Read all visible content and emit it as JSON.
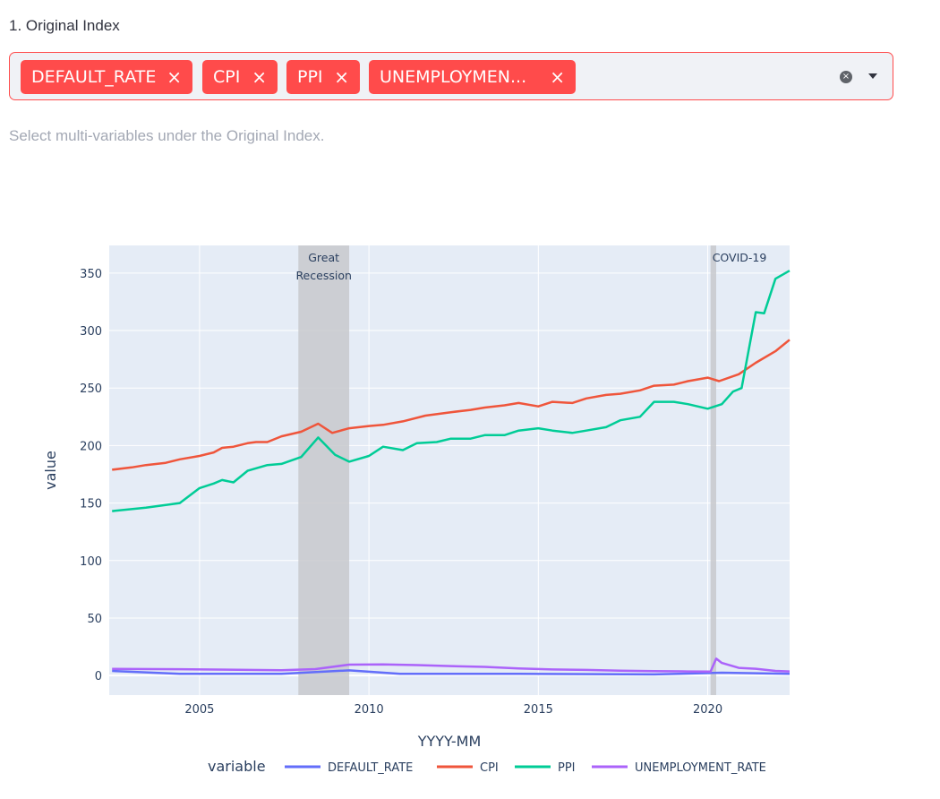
{
  "field": {
    "label": "1. Original Index",
    "chips": [
      "DEFAULT_RATE",
      "CPI",
      "PPI",
      "UNEMPLOYMEN..."
    ],
    "chip_remove_glyph": "×",
    "clear_icon": "clear-icon",
    "dropdown_icon": "chevron-down-icon",
    "help": "Select multi-variables under the Original Index."
  },
  "colors": {
    "accent": "#ff4b4b",
    "DEFAULT_RATE": "#636efa",
    "CPI": "#ef553b",
    "PPI": "#00cc96",
    "UNEMPLOYMENT_RATE": "#ab63fa",
    "plot_bg": "#e5ecf6",
    "shade": "#c8c9cc"
  },
  "chart_data": {
    "type": "line",
    "xlabel": "YYYY-MM",
    "ylabel": "value",
    "xlim": [
      "2002-05",
      "2022-06"
    ],
    "ylim": [
      -17,
      374
    ],
    "x_ticks": [
      2005,
      2010,
      2015,
      2020
    ],
    "y_ticks": [
      0,
      50,
      100,
      150,
      200,
      250,
      300,
      350
    ],
    "grid": true,
    "legend": {
      "title": "variable",
      "position": "bottom"
    },
    "shaded_regions": [
      {
        "label_lines": [
          "Great",
          "Recession"
        ],
        "start": "2007-12",
        "end": "2009-06"
      },
      {
        "label_lines": [
          "COVID-19"
        ],
        "start": "2020-02",
        "end": "2020-04"
      }
    ],
    "series": [
      {
        "name": "DEFAULT_RATE",
        "points": [
          [
            "2002-06",
            4
          ],
          [
            "2004-06",
            1.5
          ],
          [
            "2007-06",
            1.5
          ],
          [
            "2009-06",
            4.5
          ],
          [
            "2010-12",
            1.5
          ],
          [
            "2014-06",
            1.5
          ],
          [
            "2018-06",
            1
          ],
          [
            "2020-06",
            2.5
          ],
          [
            "2022-06",
            1.5
          ]
        ]
      },
      {
        "name": "CPI",
        "points": [
          [
            "2002-06",
            179
          ],
          [
            "2003-01",
            181
          ],
          [
            "2003-06",
            183
          ],
          [
            "2004-01",
            185
          ],
          [
            "2004-06",
            188
          ],
          [
            "2005-01",
            191
          ],
          [
            "2005-06",
            194
          ],
          [
            "2005-09",
            198
          ],
          [
            "2006-01",
            199
          ],
          [
            "2006-06",
            202
          ],
          [
            "2006-09",
            203
          ],
          [
            "2007-01",
            203
          ],
          [
            "2007-06",
            208
          ],
          [
            "2008-01",
            212
          ],
          [
            "2008-07",
            219
          ],
          [
            "2008-12",
            211
          ],
          [
            "2009-06",
            215
          ],
          [
            "2010-01",
            217
          ],
          [
            "2010-06",
            218
          ],
          [
            "2011-01",
            221
          ],
          [
            "2011-09",
            226
          ],
          [
            "2012-06",
            229
          ],
          [
            "2013-01",
            231
          ],
          [
            "2013-06",
            233
          ],
          [
            "2014-01",
            235
          ],
          [
            "2014-06",
            237
          ],
          [
            "2015-01",
            234
          ],
          [
            "2015-06",
            238
          ],
          [
            "2016-01",
            237
          ],
          [
            "2016-06",
            241
          ],
          [
            "2017-01",
            244
          ],
          [
            "2017-06",
            245
          ],
          [
            "2018-01",
            248
          ],
          [
            "2018-06",
            252
          ],
          [
            "2019-01",
            253
          ],
          [
            "2019-06",
            256
          ],
          [
            "2020-01",
            259
          ],
          [
            "2020-05",
            256
          ],
          [
            "2020-12",
            262
          ],
          [
            "2021-06",
            272
          ],
          [
            "2022-01",
            282
          ],
          [
            "2022-06",
            292
          ]
        ]
      },
      {
        "name": "PPI",
        "points": [
          [
            "2002-06",
            143
          ],
          [
            "2003-06",
            146
          ],
          [
            "2004-06",
            150
          ],
          [
            "2005-01",
            163
          ],
          [
            "2005-06",
            167
          ],
          [
            "2005-09",
            170
          ],
          [
            "2006-01",
            168
          ],
          [
            "2006-06",
            178
          ],
          [
            "2007-01",
            183
          ],
          [
            "2007-06",
            184
          ],
          [
            "2008-01",
            190
          ],
          [
            "2008-07",
            207
          ],
          [
            "2009-01",
            192
          ],
          [
            "2009-06",
            186
          ],
          [
            "2010-01",
            191
          ],
          [
            "2010-06",
            199
          ],
          [
            "2011-01",
            196
          ],
          [
            "2011-06",
            202
          ],
          [
            "2012-01",
            203
          ],
          [
            "2012-06",
            206
          ],
          [
            "2013-01",
            206
          ],
          [
            "2013-06",
            209
          ],
          [
            "2014-01",
            209
          ],
          [
            "2014-06",
            213
          ],
          [
            "2015-01",
            215
          ],
          [
            "2015-06",
            213
          ],
          [
            "2016-01",
            211
          ],
          [
            "2016-06",
            213
          ],
          [
            "2017-01",
            216
          ],
          [
            "2017-06",
            222
          ],
          [
            "2018-01",
            225
          ],
          [
            "2018-06",
            238
          ],
          [
            "2019-01",
            238
          ],
          [
            "2019-06",
            236
          ],
          [
            "2020-01",
            232
          ],
          [
            "2020-06",
            236
          ],
          [
            "2020-10",
            247
          ],
          [
            "2021-01",
            250
          ],
          [
            "2021-06",
            316
          ],
          [
            "2021-09",
            315
          ],
          [
            "2022-01",
            345
          ],
          [
            "2022-06",
            352
          ]
        ]
      },
      {
        "name": "UNEMPLOYMENT_RATE",
        "points": [
          [
            "2002-06",
            5.8
          ],
          [
            "2004-06",
            5.5
          ],
          [
            "2007-06",
            4.6
          ],
          [
            "2008-06",
            5.6
          ],
          [
            "2009-06",
            9.5
          ],
          [
            "2010-06",
            9.6
          ],
          [
            "2011-06",
            9.1
          ],
          [
            "2012-06",
            8.2
          ],
          [
            "2013-06",
            7.5
          ],
          [
            "2014-06",
            6.1
          ],
          [
            "2015-06",
            5.3
          ],
          [
            "2016-06",
            4.9
          ],
          [
            "2017-06",
            4.3
          ],
          [
            "2018-06",
            3.9
          ],
          [
            "2019-06",
            3.6
          ],
          [
            "2020-02",
            3.5
          ],
          [
            "2020-04",
            14.7
          ],
          [
            "2020-06",
            11
          ],
          [
            "2020-12",
            6.7
          ],
          [
            "2021-06",
            5.9
          ],
          [
            "2022-01",
            4
          ],
          [
            "2022-06",
            3.6
          ]
        ]
      }
    ]
  }
}
